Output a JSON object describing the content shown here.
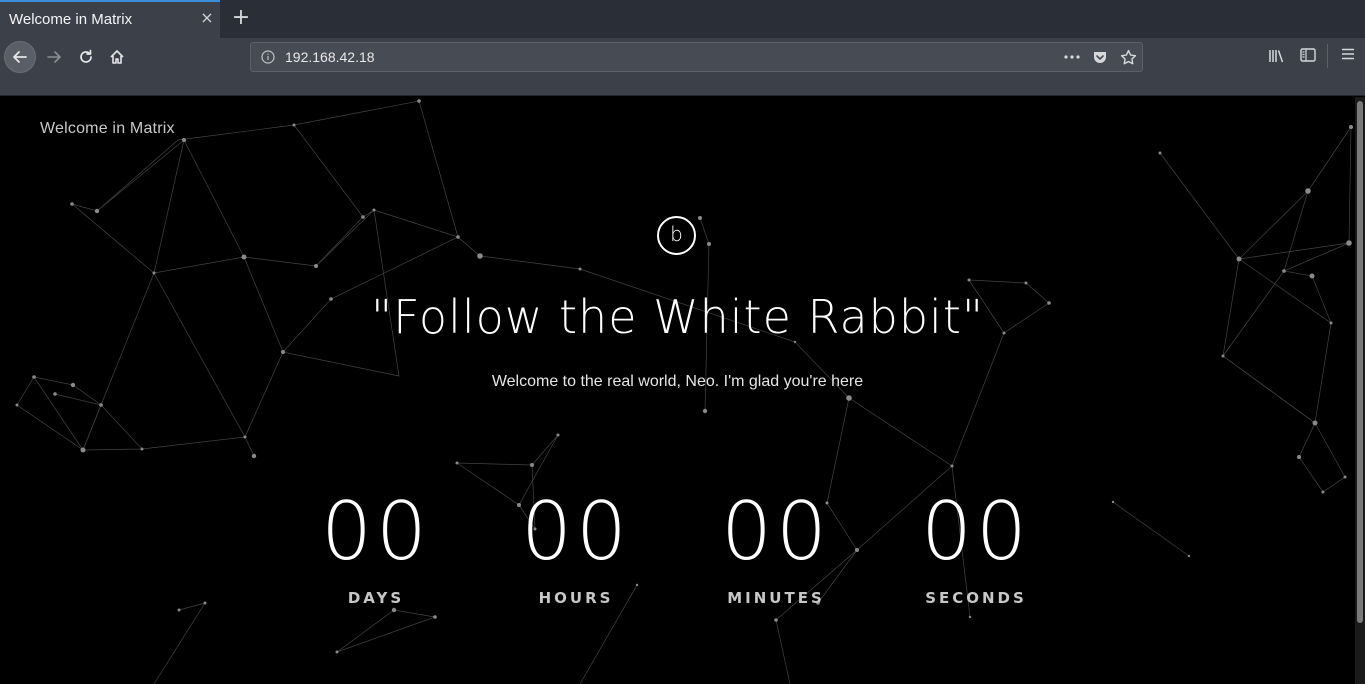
{
  "browser": {
    "tab": {
      "title": "Welcome in Matrix",
      "close_glyph": "×"
    },
    "new_tab_glyph": "+",
    "nav": {
      "back_icon": "arrow-left-icon",
      "forward_icon": "arrow-right-icon",
      "reload_icon": "reload-icon",
      "home_icon": "home-icon"
    },
    "url": {
      "value": "192.168.42.18",
      "info_icon": "info-icon"
    },
    "url_actions": [
      "more-icon",
      "pocket-icon",
      "star-icon"
    ],
    "right_tools": [
      "library-icon",
      "sidebar-icon",
      "hamburger-menu-icon"
    ]
  },
  "page": {
    "brand": "Welcome in Matrix",
    "logo_letter": "b",
    "headline": "\"Follow the White Rabbit\"",
    "subline": "Welcome to the real world, Neo. I'm glad you're here",
    "countdown": [
      {
        "value": "00",
        "label": "DAYS"
      },
      {
        "value": "00",
        "label": "HOURS"
      },
      {
        "value": "00",
        "label": "MINUTES"
      },
      {
        "value": "00",
        "label": "SECONDS"
      }
    ]
  },
  "colors": {
    "chrome_dark": "#2a2e36",
    "chrome": "#3b4049",
    "tab_accent": "#3b8ed8",
    "page_bg": "#000000",
    "text": "#ffffff"
  }
}
